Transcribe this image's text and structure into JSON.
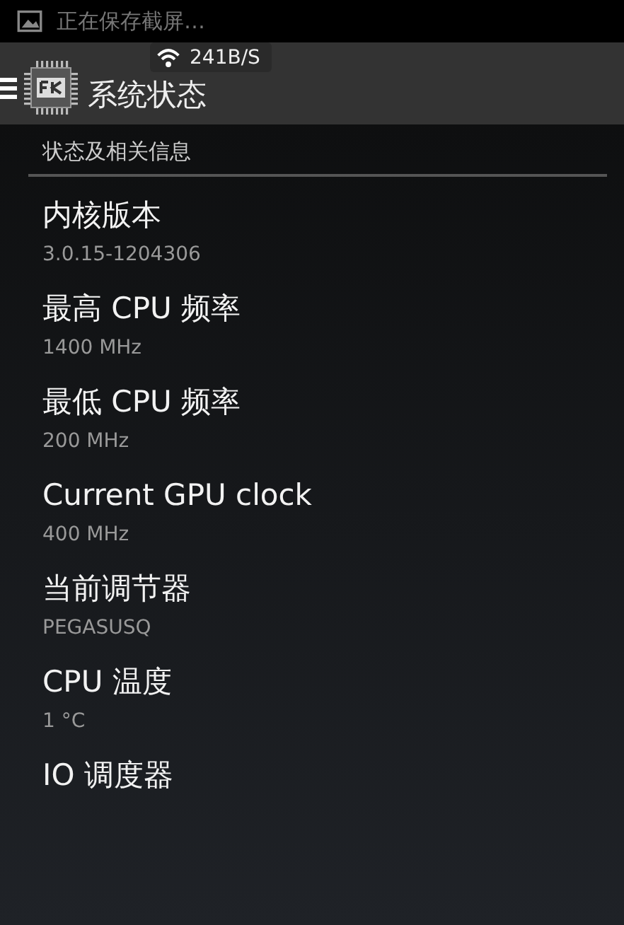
{
  "status_bar": {
    "notification": "正在保存截屏…"
  },
  "action_bar": {
    "title": "系统状态"
  },
  "toast": {
    "text": "241B/S"
  },
  "section": {
    "header": "状态及相关信息"
  },
  "items": [
    {
      "title": "内核版本",
      "value": "3.0.15-1204306"
    },
    {
      "title": "最高 CPU 频率",
      "value": "1400 MHz"
    },
    {
      "title": "最低 CPU 频率",
      "value": "200 MHz"
    },
    {
      "title": "Current GPU clock",
      "value": "400 MHz"
    },
    {
      "title": "当前调节器",
      "value": "PEGASUSQ"
    },
    {
      "title": "CPU 温度",
      "value": "1 °C"
    },
    {
      "title": "IO 调度器"
    }
  ]
}
